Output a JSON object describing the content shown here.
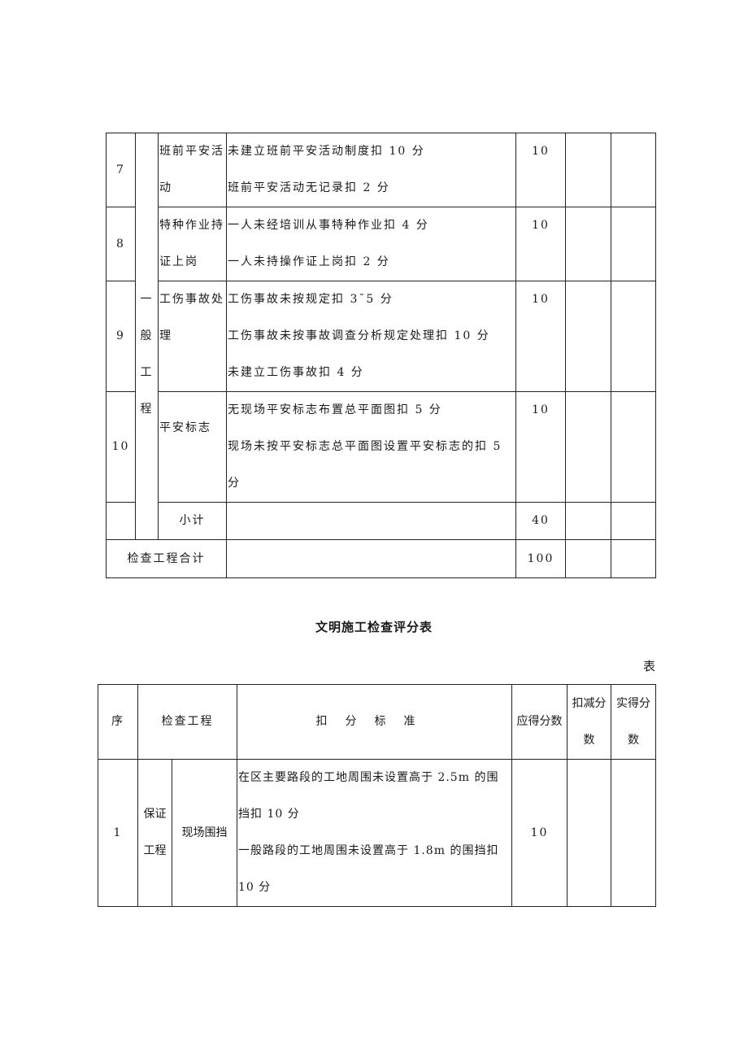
{
  "top_table": {
    "group_label": [
      "一",
      "般",
      "工",
      "程"
    ],
    "rows": [
      {
        "no": "7",
        "item_lines": [
          "班前平安活",
          "动"
        ],
        "criteria": [
          "未建立班前平安活动制度扣 10 分",
          "班前平安活动无记录扣 2 分"
        ],
        "full_score": "10",
        "deducted": "",
        "actual": ""
      },
      {
        "no": "8",
        "item_lines": [
          "特种作业持",
          "证上岗"
        ],
        "criteria": [
          "一人未经培训从事特种作业扣 4 分",
          "一人未持操作证上岗扣 2 分"
        ],
        "full_score": "10",
        "deducted": "",
        "actual": ""
      },
      {
        "no": "9",
        "item_lines": [
          "工伤事故处",
          "理"
        ],
        "criteria": [
          "工伤事故未按规定扣 3¯5 分",
          "工伤事故未按事故调查分析规定处理扣 10 分",
          "未建立工伤事故扣 4 分"
        ],
        "full_score": "10",
        "deducted": "",
        "actual": ""
      },
      {
        "no": "10",
        "item_lines": [
          "平安标志"
        ],
        "criteria": [
          "无现场平安标志布置总平面图扣 5 分",
          "现场未按平安标志总平面图设置平安标志的扣 5",
          "分"
        ],
        "full_score": "10",
        "deducted": "",
        "actual": ""
      }
    ],
    "subtotal": {
      "label": "小计",
      "full_score": "40",
      "deducted": "",
      "actual": ""
    },
    "total": {
      "label": "检查工程合计",
      "full_score": "100",
      "deducted": "",
      "actual": ""
    }
  },
  "second": {
    "title": "文明施工检查评分表",
    "table_tag": "表",
    "headers": {
      "no": "序",
      "item": "检查工程",
      "criteria": "扣分标准",
      "full_score": "应得分数",
      "deducted_lines": [
        "扣减分",
        "数"
      ],
      "actual_lines": [
        "实得分",
        "数"
      ]
    },
    "rows": [
      {
        "no": "1",
        "group_lines": [
          "保证",
          "工程"
        ],
        "item": "现场围挡",
        "criteria": [
          "在区主要路段的工地周围未设置高于 2.5m 的围",
          "挡扣 10 分",
          "一般路段的工地周围未设置高于 1.8m 的围挡扣",
          "10 分"
        ],
        "full_score": "10",
        "deducted": "",
        "actual": ""
      }
    ]
  }
}
